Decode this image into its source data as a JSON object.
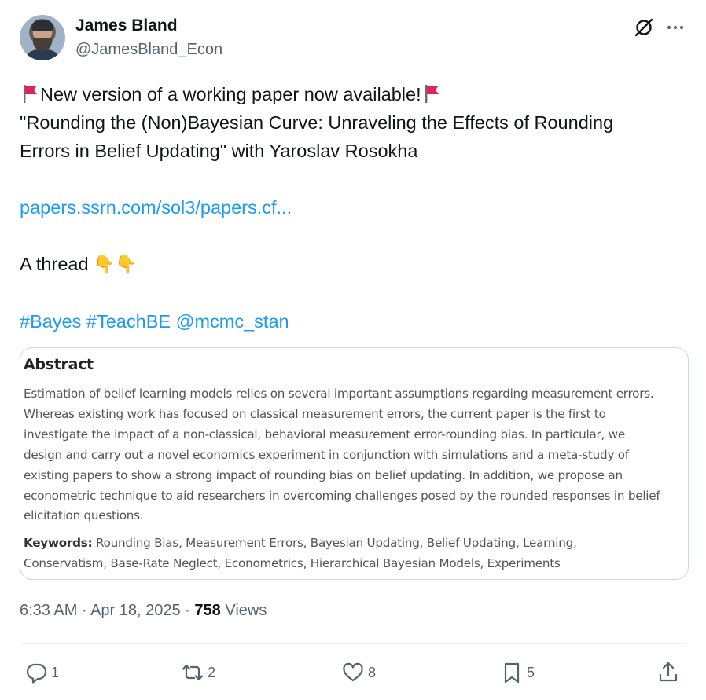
{
  "author": {
    "name": "James Bland",
    "handle": "@JamesBland_Econ"
  },
  "post": {
    "line1": "New version of a working paper now available!",
    "line2": "\"Rounding the (Non)Bayesian Curve: Unraveling the Effects of Rounding",
    "line3": "Errors in Belief Updating\" with Yaroslav Rosokha",
    "link": "papers.ssrn.com/sol3/papers.cf...",
    "thread": "A thread",
    "hashtag_bayes": "#Bayes",
    "hashtag_teachbe": "#TeachBE",
    "mention": "@mcmc_stan"
  },
  "abstract": {
    "title": "Abstract",
    "lines": [
      "Estimation of belief learning models relies on several important assumptions regarding measurement errors.",
      "Whereas existing work has focused on classical measurement errors, the current paper is the first to",
      "investigate the impact of a non-classical, behavioral measurement error-rounding bias. In particular, we",
      "design and carry out a novel economics experiment in conjunction with simulations and a meta-study of",
      "existing papers to show a strong impact of rounding bias on belief updating. In addition, we propose an",
      "econometric technique to aid researchers in overcoming challenges posed by the rounded responses in belief",
      "elicitation questions."
    ],
    "keywords_label": "Keywords:",
    "keywords_line1": "Rounding Bias, Measurement Errors, Bayesian Updating, Belief Updating, Learning,",
    "keywords_line2": "Conservatism, Base-Rate Neglect, Econometrics, Hierarchical Bayesian Models, Experiments"
  },
  "meta": {
    "time": "6:33 AM",
    "sep1": "·",
    "date": "Apr 18, 2025",
    "sep2": "·",
    "views_count": "758",
    "views_label": "Views"
  },
  "actions": {
    "replies": "1",
    "reposts": "2",
    "likes": "8",
    "bookmarks": "5"
  },
  "colors": {
    "link": "#1d9bf0",
    "muted": "#536471",
    "text": "#0f1419",
    "flag": "#e0245e"
  },
  "icons": [
    "grok-icon",
    "more-icon",
    "red-flag-icon",
    "pointing-down-icon",
    "reply-icon",
    "repost-icon",
    "like-icon",
    "bookmark-icon",
    "share-icon"
  ]
}
